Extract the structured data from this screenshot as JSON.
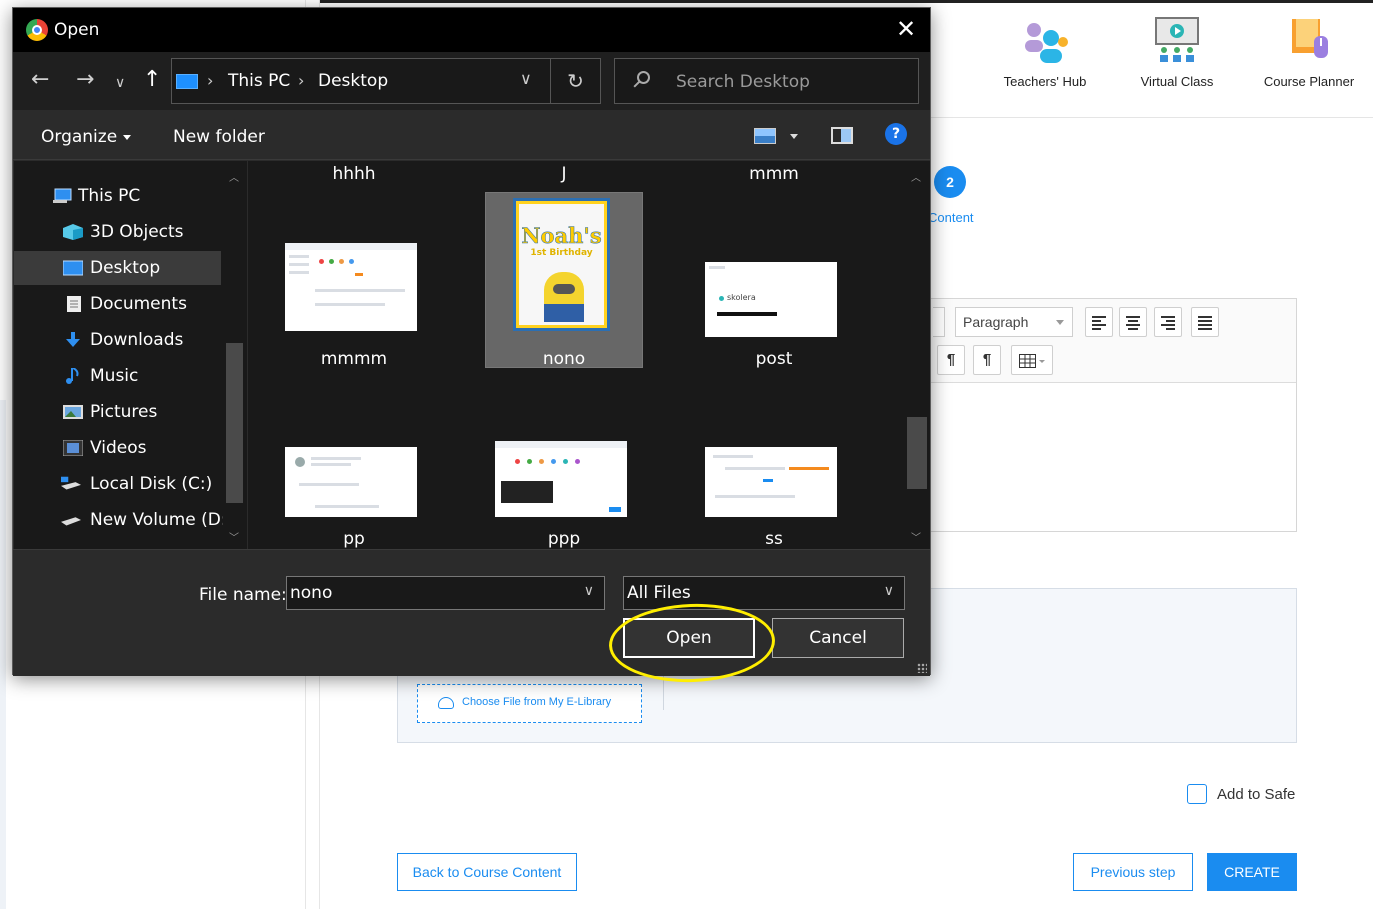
{
  "app": {
    "nav_links": [
      {
        "label": "Teachers' Hub",
        "icon": "teachers-hub-icon"
      },
      {
        "label": "Virtual Class",
        "icon": "virtual-class-icon"
      },
      {
        "label": "Course Planner",
        "icon": "course-planner-icon"
      }
    ],
    "step": {
      "number": "2",
      "label": "Content"
    },
    "editor": {
      "paragraph_select": "Paragraph"
    },
    "upload": {
      "elibrary_button": "Choose File from My E-Library"
    },
    "add_to_safe": "Add to Safe",
    "buttons": {
      "back": "Back to Course Content",
      "previous": "Previous step",
      "create": "CREATE"
    },
    "accent_color": "#1a8cf0"
  },
  "dialog": {
    "title": "Open",
    "close_glyph": "✕",
    "breadcrumb": [
      "This PC",
      "Desktop"
    ],
    "search_placeholder": "Search Desktop",
    "commands": {
      "organize": "Organize",
      "new_folder": "New folder",
      "help": "?"
    },
    "nav_items": [
      {
        "label": "This PC",
        "icon": "computer-icon"
      },
      {
        "label": "3D Objects",
        "icon": "3d-objects-icon"
      },
      {
        "label": "Desktop",
        "icon": "desktop-icon",
        "selected": true
      },
      {
        "label": "Documents",
        "icon": "documents-icon"
      },
      {
        "label": "Downloads",
        "icon": "downloads-icon"
      },
      {
        "label": "Music",
        "icon": "music-icon"
      },
      {
        "label": "Pictures",
        "icon": "pictures-icon"
      },
      {
        "label": "Videos",
        "icon": "videos-icon"
      },
      {
        "label": "Local Disk (C:)",
        "icon": "local-disk-icon"
      },
      {
        "label": "New Volume (D:)",
        "icon": "drive-icon"
      }
    ],
    "files_top_row": [
      "hhhh",
      "J",
      "mmm"
    ],
    "files": [
      "mmmm",
      "nono",
      "post",
      "pp",
      "ppp",
      "ss"
    ],
    "selected_file": "nono",
    "poster": {
      "title": "Noah's",
      "subtitle": "1st Birthday"
    },
    "thumb_brand": "skolera",
    "file_name_label": "File name:",
    "file_name_value": "nono",
    "file_type_value": "All Files",
    "open_button": "Open",
    "cancel_button": "Cancel",
    "highlight_color": "#ffee00"
  }
}
